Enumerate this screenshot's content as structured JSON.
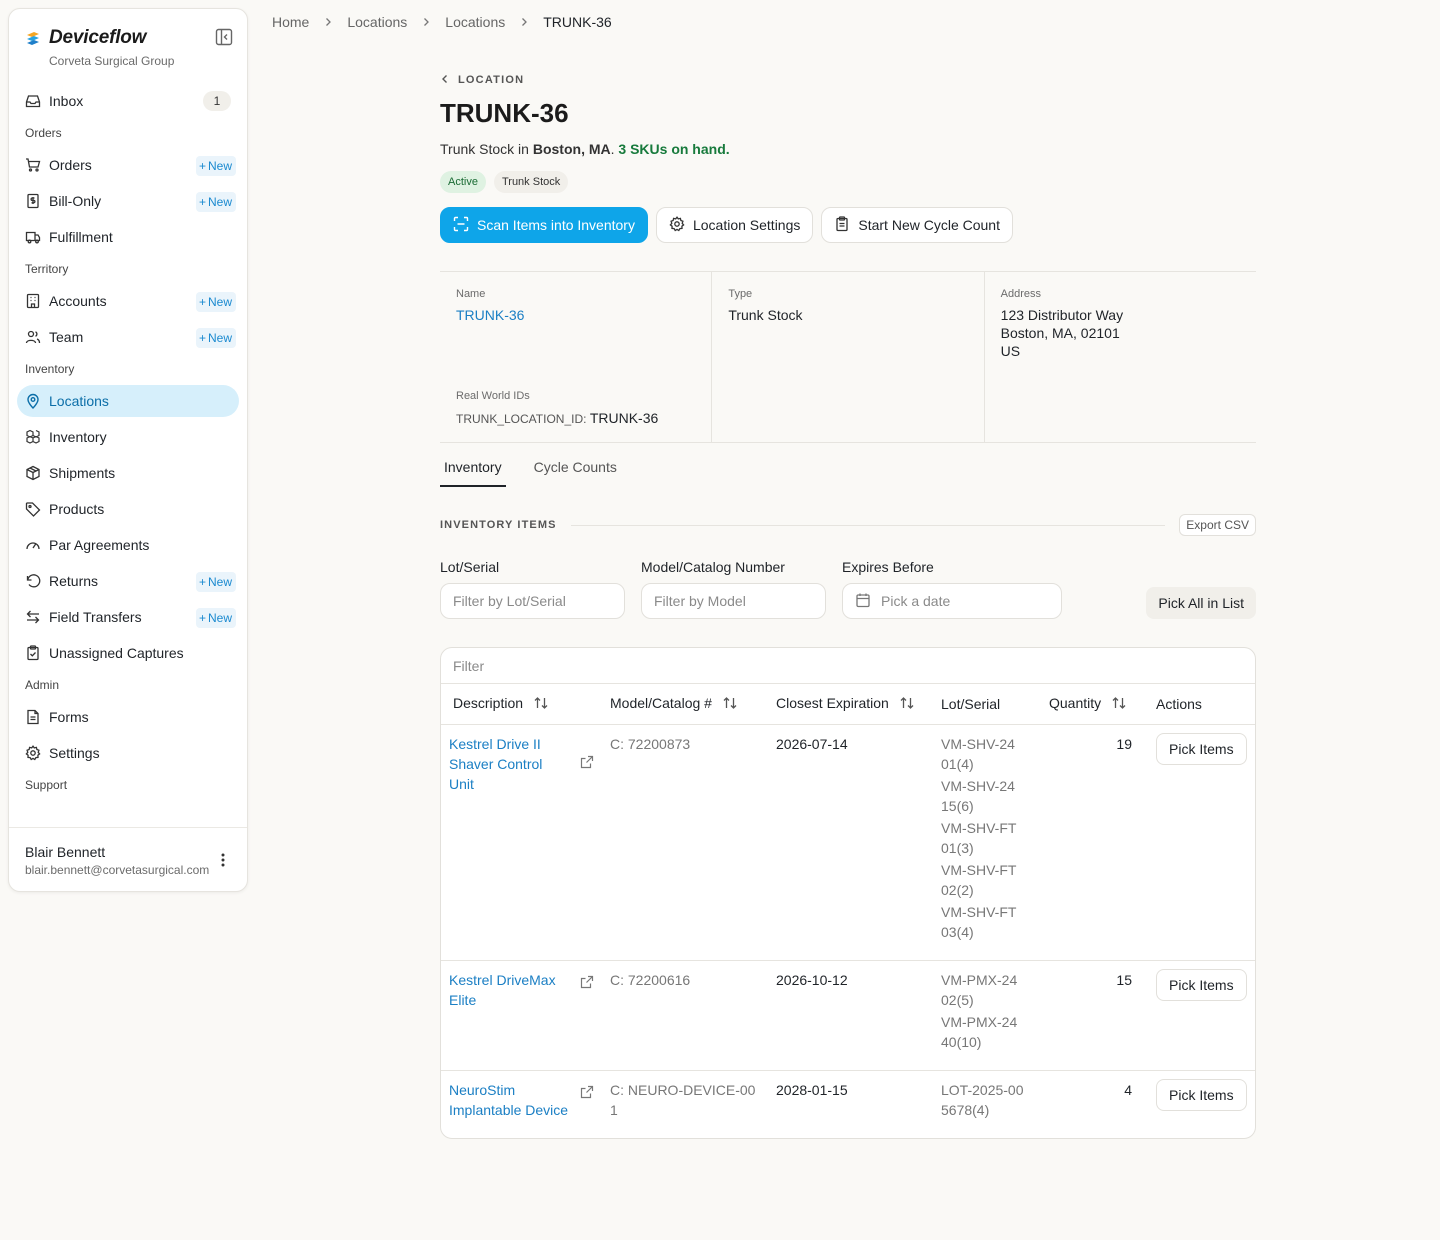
{
  "sidebar": {
    "brand": "Deviceflow",
    "org": "Corveta Surgical Group",
    "inbox": {
      "label": "Inbox",
      "count": "1"
    },
    "new_label": "New",
    "sections": {
      "orders": "Orders",
      "territory": "Territory",
      "inventory": "Inventory",
      "admin": "Admin",
      "support": "Support"
    },
    "items": {
      "orders": "Orders",
      "bill_only": "Bill-Only",
      "fulfillment": "Fulfillment",
      "accounts": "Accounts",
      "team": "Team",
      "locations": "Locations",
      "inventory": "Inventory",
      "shipments": "Shipments",
      "products": "Products",
      "par_agreements": "Par Agreements",
      "returns": "Returns",
      "field_transfers": "Field Transfers",
      "unassigned_captures": "Unassigned Captures",
      "forms": "Forms",
      "settings": "Settings"
    },
    "user": {
      "name": "Blair Bennett",
      "email": "blair.bennett@corvetasurgical.com"
    }
  },
  "breadcrumb": [
    "Home",
    "Locations",
    "Locations",
    "TRUNK-36"
  ],
  "header": {
    "back_label": "LOCATION",
    "title": "TRUNK-36",
    "subtitle_prefix": "Trunk Stock in ",
    "subtitle_city": "Boston, MA",
    "subtitle_period": ". ",
    "subtitle_skus": "3 SKUs on hand.",
    "badge_status": "Active",
    "badge_type": "Trunk Stock"
  },
  "actions": {
    "scan": "Scan Items into Inventory",
    "settings": "Location Settings",
    "cycle": "Start New Cycle Count"
  },
  "info": {
    "name_label": "Name",
    "name_value": "TRUNK-36",
    "type_label": "Type",
    "type_value": "Trunk Stock",
    "address_label": "Address",
    "address_line1": "123 Distributor Way",
    "address_line2": "Boston, MA, 02101",
    "address_line3": "US",
    "rw_label": "Real World IDs",
    "rw_key": "TRUNK_LOCATION_ID:",
    "rw_value": "TRUNK-36"
  },
  "tabs": [
    "Inventory",
    "Cycle Counts"
  ],
  "inventory_section": {
    "label": "INVENTORY ITEMS",
    "export": "Export CSV"
  },
  "filters": {
    "lot_label": "Lot/Serial",
    "lot_placeholder": "Filter by Lot/Serial",
    "model_label": "Model/Catalog Number",
    "model_placeholder": "Filter by Model",
    "expires_label": "Expires Before",
    "expires_placeholder": "Pick a date",
    "pick_all": "Pick All in List"
  },
  "table": {
    "filter_placeholder": "Filter",
    "columns": [
      "Description",
      "Model/Catalog #",
      "Closest Expiration",
      "Lot/Serial",
      "Quantity",
      "Actions"
    ],
    "action_label": "Pick Items",
    "rows": [
      {
        "description": "Kestrel Drive II Shaver Control Unit",
        "model": "C: 72200873",
        "expiration": "2026-07-14",
        "lots": [
          "VM-SHV-2401(4)",
          "VM-SHV-2415(6)",
          "VM-SHV-FT01(3)",
          "VM-SHV-FT02(2)",
          "VM-SHV-FT03(4)"
        ],
        "quantity": "19"
      },
      {
        "description": "Kestrel DriveMax Elite",
        "model": "C: 72200616",
        "expiration": "2026-10-12",
        "lots": [
          "VM-PMX-2402(5)",
          "VM-PMX-2440(10)"
        ],
        "quantity": "15"
      },
      {
        "description": "NeuroStim Implantable Device",
        "model": "C: NEURO-DEVICE-001",
        "expiration": "2028-01-15",
        "lots": [
          "LOT-2025-005678(4)"
        ],
        "quantity": "4"
      }
    ]
  },
  "colors": {
    "accent": "#0ea5e9",
    "link": "#1b7fc4",
    "active_nav_bg": "#d6effb",
    "success": "#177a3c"
  }
}
